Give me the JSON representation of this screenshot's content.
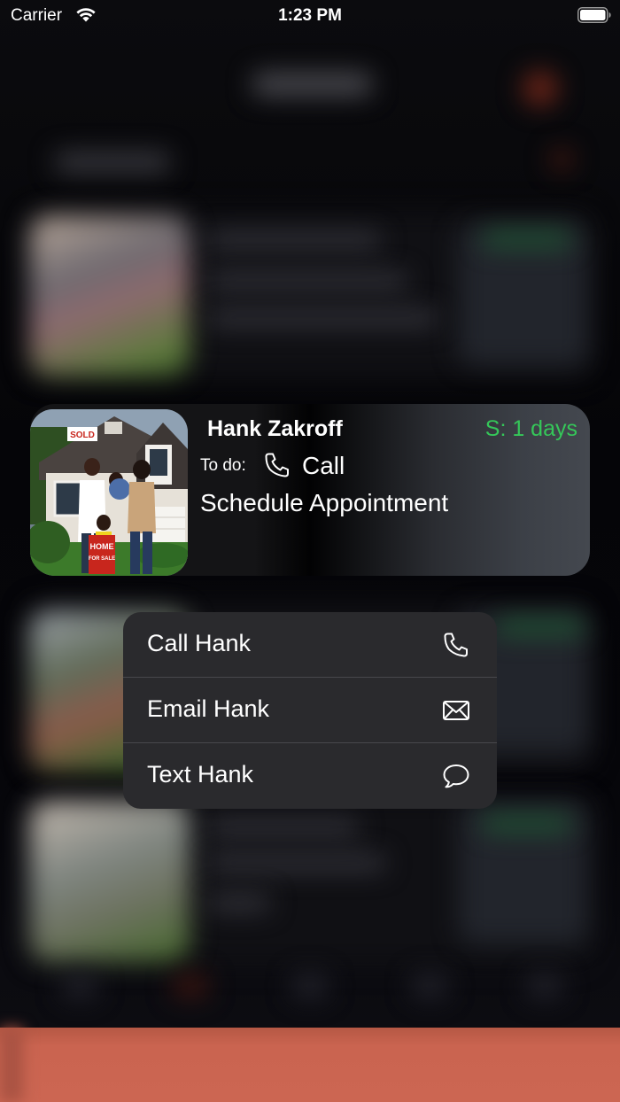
{
  "status_bar": {
    "carrier": "Carrier",
    "time": "1:23 PM"
  },
  "card": {
    "name": "Hank Zakroff",
    "days": "S: 1 days",
    "todo_label": "To do:",
    "todo_action": "Call",
    "task": "Schedule Appointment",
    "photo_sign_sold": "SOLD",
    "photo_sign_home": "HOME",
    "photo_sign_for_sale": "FOR SALE",
    "days_color": "#35c759"
  },
  "menu": {
    "items": [
      {
        "label": "Call Hank",
        "icon": "phone-icon"
      },
      {
        "label": "Email Hank",
        "icon": "envelope-icon"
      },
      {
        "label": "Text Hank",
        "icon": "speech-bubble-icon"
      }
    ]
  },
  "colors": {
    "accent_bottom_bar": "#cc6652",
    "menu_background": "#2a2a2d"
  }
}
